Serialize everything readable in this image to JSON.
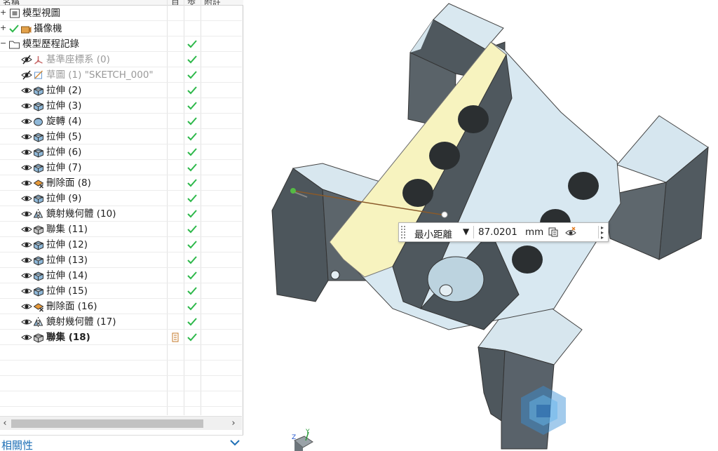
{
  "navigator": {
    "header": {
      "col_name": "名稱",
      "col_a": "目",
      "col_b": "歩",
      "col_c": "附註"
    },
    "rows": [
      {
        "indent": 0,
        "expander": "+",
        "label": "模型視圖",
        "icon": "model-view-icon",
        "checked": false,
        "eye": "none",
        "bold": false,
        "dim": false
      },
      {
        "indent": 0,
        "expander": "+",
        "label": "攝像機",
        "icon": "camera-icon",
        "checked": false,
        "eye": "check",
        "bold": false,
        "dim": false
      },
      {
        "indent": 0,
        "expander": "−",
        "label": "模型歷程記錄",
        "icon": "folder-icon",
        "checked": true,
        "eye": "none",
        "bold": false,
        "dim": false
      },
      {
        "indent": 1,
        "expander": "",
        "label": "基準座標系 (0)",
        "icon": "datum-csys-icon",
        "checked": true,
        "eye": "hidden",
        "bold": false,
        "dim": true
      },
      {
        "indent": 1,
        "expander": "",
        "label": "草圖 (1) \"SKETCH_000\"",
        "icon": "sketch-icon",
        "checked": true,
        "eye": "hidden",
        "bold": false,
        "dim": true
      },
      {
        "indent": 1,
        "expander": "",
        "label": "拉伸 (2)",
        "icon": "extrude-icon",
        "checked": true,
        "eye": "visible",
        "bold": false,
        "dim": false
      },
      {
        "indent": 1,
        "expander": "",
        "label": "拉伸 (3)",
        "icon": "extrude-icon",
        "checked": true,
        "eye": "visible",
        "bold": false,
        "dim": false
      },
      {
        "indent": 1,
        "expander": "",
        "label": "旋轉 (4)",
        "icon": "revolve-icon",
        "checked": true,
        "eye": "visible",
        "bold": false,
        "dim": false
      },
      {
        "indent": 1,
        "expander": "",
        "label": "拉伸 (5)",
        "icon": "extrude-icon",
        "checked": true,
        "eye": "visible",
        "bold": false,
        "dim": false
      },
      {
        "indent": 1,
        "expander": "",
        "label": "拉伸 (6)",
        "icon": "extrude-icon",
        "checked": true,
        "eye": "visible",
        "bold": false,
        "dim": false
      },
      {
        "indent": 1,
        "expander": "",
        "label": "拉伸 (7)",
        "icon": "extrude-icon",
        "checked": true,
        "eye": "visible",
        "bold": false,
        "dim": false
      },
      {
        "indent": 1,
        "expander": "",
        "label": "刪除面 (8)",
        "icon": "delete-face-icon",
        "checked": true,
        "eye": "visible",
        "bold": false,
        "dim": false
      },
      {
        "indent": 1,
        "expander": "",
        "label": "拉伸 (9)",
        "icon": "extrude-icon",
        "checked": true,
        "eye": "visible",
        "bold": false,
        "dim": false
      },
      {
        "indent": 1,
        "expander": "",
        "label": "鏡射幾何體 (10)",
        "icon": "mirror-geometry-icon",
        "checked": true,
        "eye": "visible",
        "bold": false,
        "dim": false
      },
      {
        "indent": 1,
        "expander": "",
        "label": "聯集 (11)",
        "icon": "unite-icon",
        "checked": true,
        "eye": "visible",
        "bold": false,
        "dim": false
      },
      {
        "indent": 1,
        "expander": "",
        "label": "拉伸 (12)",
        "icon": "extrude-icon",
        "checked": true,
        "eye": "visible",
        "bold": false,
        "dim": false
      },
      {
        "indent": 1,
        "expander": "",
        "label": "拉伸 (13)",
        "icon": "extrude-icon",
        "checked": true,
        "eye": "visible",
        "bold": false,
        "dim": false
      },
      {
        "indent": 1,
        "expander": "",
        "label": "拉伸 (14)",
        "icon": "extrude-icon",
        "checked": true,
        "eye": "visible",
        "bold": false,
        "dim": false
      },
      {
        "indent": 1,
        "expander": "",
        "label": "拉伸 (15)",
        "icon": "extrude-icon",
        "checked": true,
        "eye": "visible",
        "bold": false,
        "dim": false
      },
      {
        "indent": 1,
        "expander": "",
        "label": "刪除面 (16)",
        "icon": "delete-face-icon",
        "checked": true,
        "eye": "visible",
        "bold": false,
        "dim": false
      },
      {
        "indent": 1,
        "expander": "",
        "label": "鏡射幾何體 (17)",
        "icon": "mirror-geometry-icon",
        "checked": true,
        "eye": "visible",
        "bold": false,
        "dim": false
      },
      {
        "indent": 1,
        "expander": "",
        "label": "聯集 (18)",
        "icon": "unite-icon",
        "checked": true,
        "eye": "visible",
        "bold": true,
        "dim": false,
        "extra_icon": "current-feature-icon"
      }
    ]
  },
  "related_panel": {
    "title": "相關性"
  },
  "measure": {
    "type": "最小距離",
    "value": "87.0201",
    "unit": "mm"
  },
  "triad": {
    "y_label": "Y",
    "z_label": "Z"
  },
  "colors": {
    "check": "#2db84a",
    "accent_blue": "#1e6fb6",
    "selected_face": "#f7f3bf",
    "model_light": "#d7e7ef",
    "model_dark": "#535d63"
  }
}
